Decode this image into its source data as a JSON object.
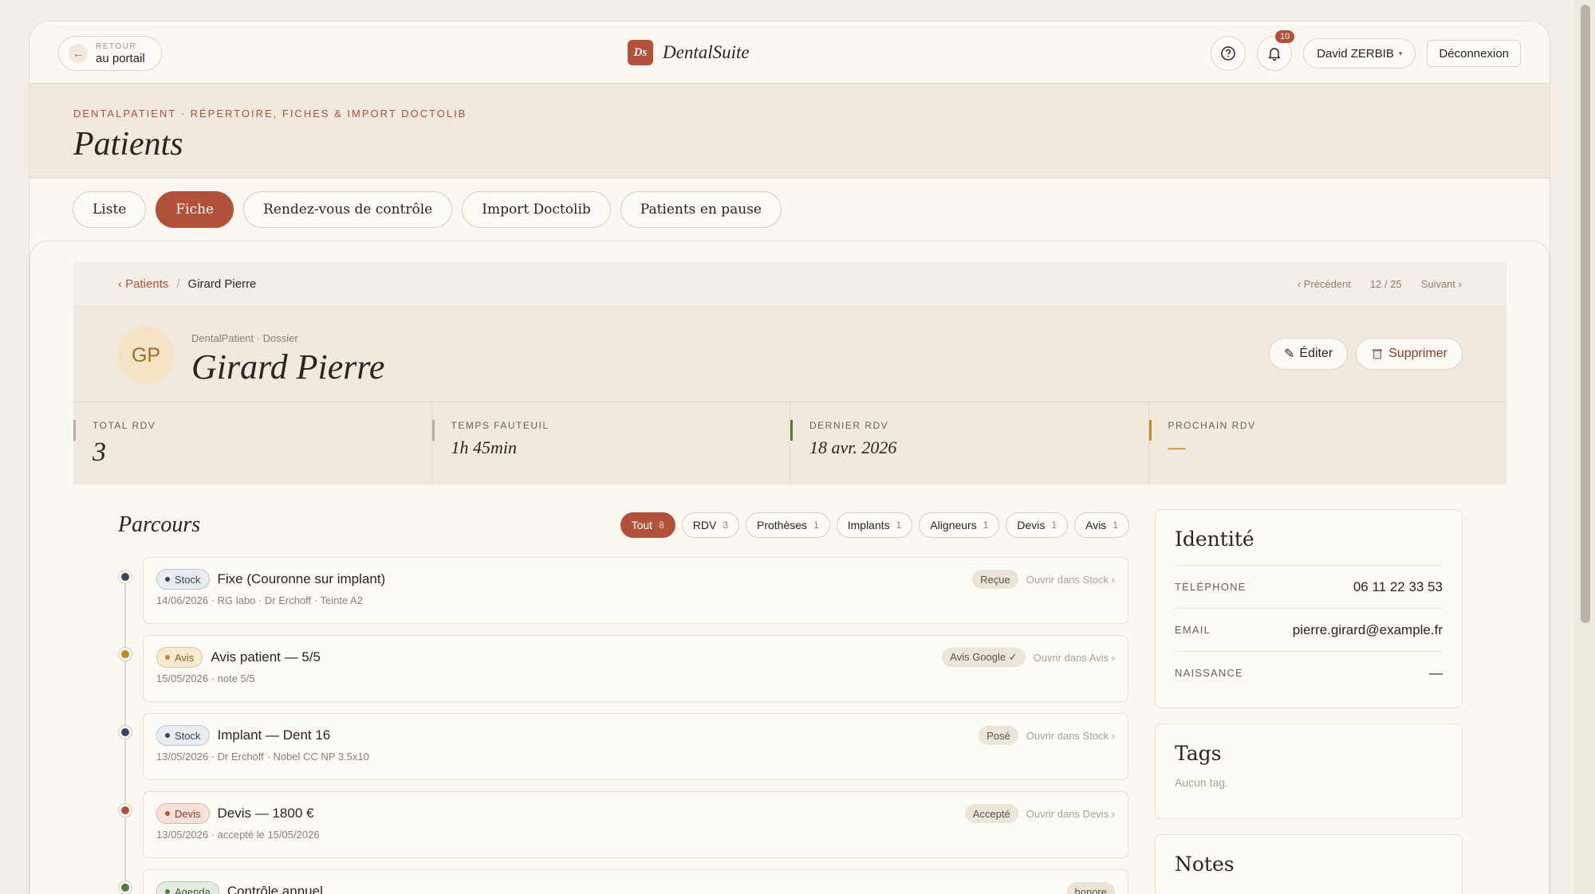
{
  "topbar": {
    "back_small": "RETOUR",
    "back_main": "au portail",
    "brand_logo": "Ds",
    "brand_name": "DentalSuite",
    "notif_count": "10",
    "user_name": "David ZERBIB",
    "user_caret": "▾",
    "logout_label": "Déconnexion"
  },
  "header": {
    "eyebrow": "DENTALPATIENT · RÉPERTOIRE, FICHES & IMPORT DOCTOLIB",
    "title": "Patients"
  },
  "tabs": [
    {
      "label": "Liste"
    },
    {
      "label": "Fiche"
    },
    {
      "label": "Rendez-vous de contrôle"
    },
    {
      "label": "Import Doctolib"
    },
    {
      "label": "Patients en pause"
    }
  ],
  "breadcrumb": {
    "parent": "‹ Patients",
    "separator": "/",
    "current": "Girard Pierre",
    "prev": "‹ Précédent",
    "position": "12 / 25",
    "next": "Suivant ›"
  },
  "patient": {
    "initials": "GP",
    "dossier_label": "DentalPatient · Dossier",
    "name": "Girard Pierre",
    "edit_label": "Éditer",
    "delete_label": "Supprimer"
  },
  "stats": [
    {
      "label": "TOTAL RDV",
      "value": "3",
      "color": "#b8ada0"
    },
    {
      "label": "TEMPS FAUTEUIL",
      "value": "1h 45min",
      "color": "#b8ada0"
    },
    {
      "label": "DERNIER RDV",
      "value": "18 avr. 2026",
      "color": "#557a46"
    },
    {
      "label": "PROCHAIN RDV",
      "value": "—",
      "color": "#c18a23"
    }
  ],
  "parcours": {
    "title": "Parcours",
    "filters": [
      {
        "label": "Tout",
        "count": "8"
      },
      {
        "label": "RDV",
        "count": "3"
      },
      {
        "label": "Prothèses",
        "count": "1"
      },
      {
        "label": "Implants",
        "count": "1"
      },
      {
        "label": "Aligneurs",
        "count": "1"
      },
      {
        "label": "Devis",
        "count": "1"
      },
      {
        "label": "Avis",
        "count": "1"
      }
    ],
    "events": [
      {
        "tag": "Stock",
        "title": "Fixe (Couronne sur implant)",
        "status": "Reçue",
        "link": "Ouvrir dans Stock ›",
        "meta": "14/06/2026 · RG labo · Dr Erchoff · Teinte A2"
      },
      {
        "tag": "Avis",
        "title": "Avis patient — 5/5",
        "status": "Avis Google ✓",
        "link": "Ouvrir dans Avis ›",
        "meta": "15/05/2026 · note 5/5"
      },
      {
        "tag": "Stock",
        "title": "Implant — Dent 16",
        "status": "Posé",
        "link": "Ouvrir dans Stock ›",
        "meta": "13/05/2026 · Dr Erchoff · Nobel CC NP 3.5x10"
      },
      {
        "tag": "Devis",
        "title": "Devis — 1800 €",
        "status": "Accepté",
        "link": "Ouvrir dans Devis ›",
        "meta": "13/05/2026 · accepté le 15/05/2026"
      },
      {
        "tag": "Agenda",
        "title": "Contrôle annuel",
        "status": "honore",
        "link": "",
        "meta": ""
      }
    ]
  },
  "identity": {
    "title": "Identité",
    "rows": [
      {
        "label": "TÉLÉPHONE",
        "value": "06 11 22 33 53"
      },
      {
        "label": "EMAIL",
        "value": "pierre.girard@example.fr"
      },
      {
        "label": "NAISSANCE",
        "value": "—"
      }
    ]
  },
  "tags_panel": {
    "title": "Tags",
    "empty": "Aucun tag."
  },
  "notes_panel": {
    "title": "Notes"
  },
  "colors": {
    "accent": "#b2513a",
    "background": "#fbf8f1"
  }
}
